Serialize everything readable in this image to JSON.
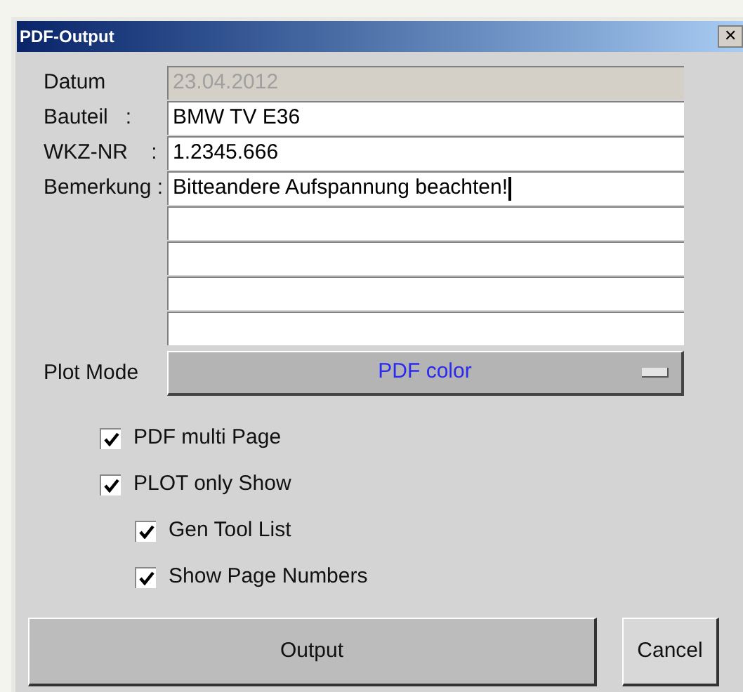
{
  "window": {
    "title": "PDF-Output",
    "close": "✕"
  },
  "fields": [
    {
      "label": "Datum",
      "value": "23.04.2012",
      "disabled": true,
      "focused": false
    },
    {
      "label": "Bauteil   :",
      "value": "BMW TV E36",
      "disabled": false,
      "focused": false
    },
    {
      "label": "WKZ-NR    :",
      "value": "1.2345.666",
      "disabled": false,
      "focused": false
    },
    {
      "label": "Bemerkung :",
      "value": "Bitteandere Aufspannung beachten!",
      "disabled": false,
      "focused": true
    },
    {
      "disabled": false,
      "focused": false
    },
    {
      "disabled": false,
      "focused": false
    },
    {
      "disabled": false,
      "focused": false
    },
    {
      "disabled": false,
      "focused": false
    }
  ],
  "plot_mode": {
    "label": "Plot Mode",
    "value": "PDF color"
  },
  "options": [
    {
      "label": "PDF multi Page",
      "checked": true
    },
    {
      "label": "PLOT only Show",
      "checked": true,
      "children": [
        {
          "label": "Gen Tool List",
          "checked": true
        },
        {
          "label": "Show Page Numbers",
          "checked": true
        }
      ]
    }
  ],
  "buttons": [
    {
      "kind": "primary",
      "label": "Output"
    },
    {
      "kind": "secondary",
      "label": "Cancel"
    }
  ]
}
